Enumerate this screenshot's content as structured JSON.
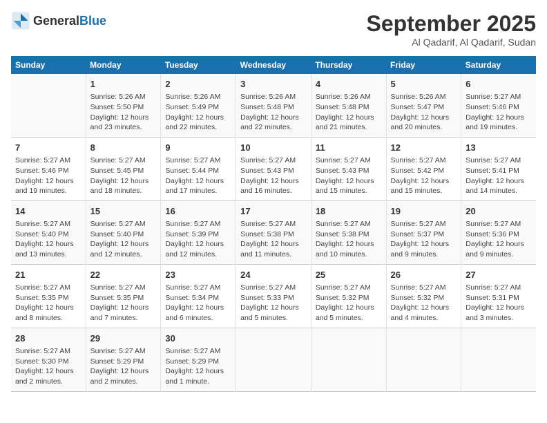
{
  "logo": {
    "text_general": "General",
    "text_blue": "Blue"
  },
  "header": {
    "month_year": "September 2025",
    "location": "Al Qadarif, Al Qadarif, Sudan"
  },
  "days_of_week": [
    "Sunday",
    "Monday",
    "Tuesday",
    "Wednesday",
    "Thursday",
    "Friday",
    "Saturday"
  ],
  "weeks": [
    [
      {
        "day": "",
        "info": ""
      },
      {
        "day": "1",
        "info": "Sunrise: 5:26 AM\nSunset: 5:50 PM\nDaylight: 12 hours\nand 23 minutes."
      },
      {
        "day": "2",
        "info": "Sunrise: 5:26 AM\nSunset: 5:49 PM\nDaylight: 12 hours\nand 22 minutes."
      },
      {
        "day": "3",
        "info": "Sunrise: 5:26 AM\nSunset: 5:48 PM\nDaylight: 12 hours\nand 22 minutes."
      },
      {
        "day": "4",
        "info": "Sunrise: 5:26 AM\nSunset: 5:48 PM\nDaylight: 12 hours\nand 21 minutes."
      },
      {
        "day": "5",
        "info": "Sunrise: 5:26 AM\nSunset: 5:47 PM\nDaylight: 12 hours\nand 20 minutes."
      },
      {
        "day": "6",
        "info": "Sunrise: 5:27 AM\nSunset: 5:46 PM\nDaylight: 12 hours\nand 19 minutes."
      }
    ],
    [
      {
        "day": "7",
        "info": "Sunrise: 5:27 AM\nSunset: 5:46 PM\nDaylight: 12 hours\nand 19 minutes."
      },
      {
        "day": "8",
        "info": "Sunrise: 5:27 AM\nSunset: 5:45 PM\nDaylight: 12 hours\nand 18 minutes."
      },
      {
        "day": "9",
        "info": "Sunrise: 5:27 AM\nSunset: 5:44 PM\nDaylight: 12 hours\nand 17 minutes."
      },
      {
        "day": "10",
        "info": "Sunrise: 5:27 AM\nSunset: 5:43 PM\nDaylight: 12 hours\nand 16 minutes."
      },
      {
        "day": "11",
        "info": "Sunrise: 5:27 AM\nSunset: 5:43 PM\nDaylight: 12 hours\nand 15 minutes."
      },
      {
        "day": "12",
        "info": "Sunrise: 5:27 AM\nSunset: 5:42 PM\nDaylight: 12 hours\nand 15 minutes."
      },
      {
        "day": "13",
        "info": "Sunrise: 5:27 AM\nSunset: 5:41 PM\nDaylight: 12 hours\nand 14 minutes."
      }
    ],
    [
      {
        "day": "14",
        "info": "Sunrise: 5:27 AM\nSunset: 5:40 PM\nDaylight: 12 hours\nand 13 minutes."
      },
      {
        "day": "15",
        "info": "Sunrise: 5:27 AM\nSunset: 5:40 PM\nDaylight: 12 hours\nand 12 minutes."
      },
      {
        "day": "16",
        "info": "Sunrise: 5:27 AM\nSunset: 5:39 PM\nDaylight: 12 hours\nand 12 minutes."
      },
      {
        "day": "17",
        "info": "Sunrise: 5:27 AM\nSunset: 5:38 PM\nDaylight: 12 hours\nand 11 minutes."
      },
      {
        "day": "18",
        "info": "Sunrise: 5:27 AM\nSunset: 5:38 PM\nDaylight: 12 hours\nand 10 minutes."
      },
      {
        "day": "19",
        "info": "Sunrise: 5:27 AM\nSunset: 5:37 PM\nDaylight: 12 hours\nand 9 minutes."
      },
      {
        "day": "20",
        "info": "Sunrise: 5:27 AM\nSunset: 5:36 PM\nDaylight: 12 hours\nand 9 minutes."
      }
    ],
    [
      {
        "day": "21",
        "info": "Sunrise: 5:27 AM\nSunset: 5:35 PM\nDaylight: 12 hours\nand 8 minutes."
      },
      {
        "day": "22",
        "info": "Sunrise: 5:27 AM\nSunset: 5:35 PM\nDaylight: 12 hours\nand 7 minutes."
      },
      {
        "day": "23",
        "info": "Sunrise: 5:27 AM\nSunset: 5:34 PM\nDaylight: 12 hours\nand 6 minutes."
      },
      {
        "day": "24",
        "info": "Sunrise: 5:27 AM\nSunset: 5:33 PM\nDaylight: 12 hours\nand 5 minutes."
      },
      {
        "day": "25",
        "info": "Sunrise: 5:27 AM\nSunset: 5:32 PM\nDaylight: 12 hours\nand 5 minutes."
      },
      {
        "day": "26",
        "info": "Sunrise: 5:27 AM\nSunset: 5:32 PM\nDaylight: 12 hours\nand 4 minutes."
      },
      {
        "day": "27",
        "info": "Sunrise: 5:27 AM\nSunset: 5:31 PM\nDaylight: 12 hours\nand 3 minutes."
      }
    ],
    [
      {
        "day": "28",
        "info": "Sunrise: 5:27 AM\nSunset: 5:30 PM\nDaylight: 12 hours\nand 2 minutes."
      },
      {
        "day": "29",
        "info": "Sunrise: 5:27 AM\nSunset: 5:29 PM\nDaylight: 12 hours\nand 2 minutes."
      },
      {
        "day": "30",
        "info": "Sunrise: 5:27 AM\nSunset: 5:29 PM\nDaylight: 12 hours\nand 1 minute."
      },
      {
        "day": "",
        "info": ""
      },
      {
        "day": "",
        "info": ""
      },
      {
        "day": "",
        "info": ""
      },
      {
        "day": "",
        "info": ""
      }
    ]
  ]
}
